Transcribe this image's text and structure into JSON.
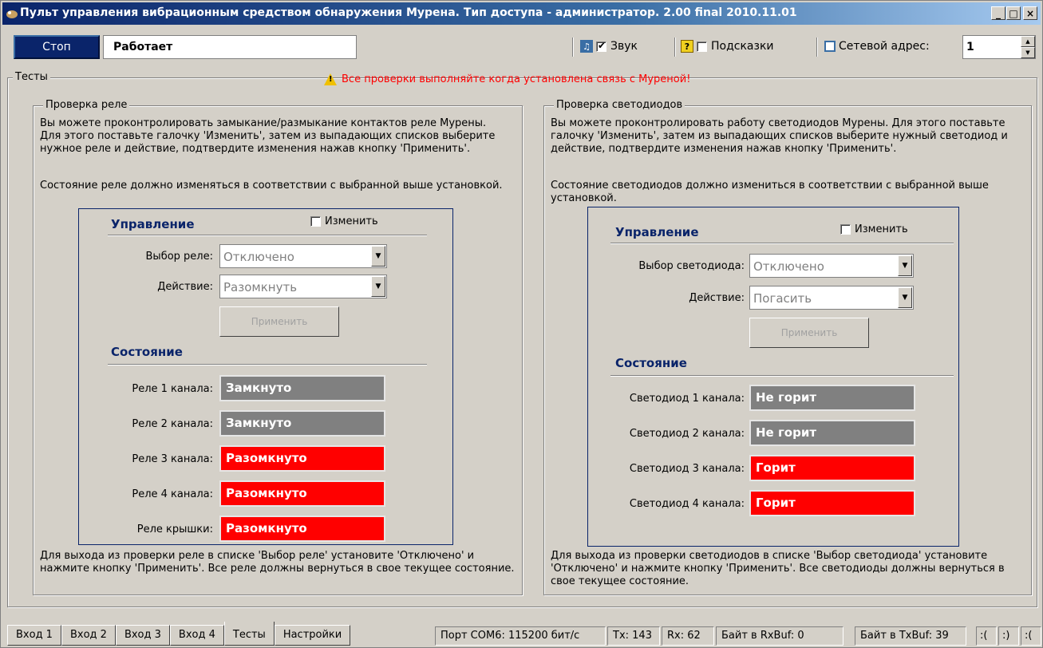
{
  "window": {
    "title": "Пульт управления вибрационным средством обнаружения Мурена. Тип доступа - администратор. 2.00 final 2010.11.01",
    "controls": [
      "_",
      "□",
      "×"
    ]
  },
  "toolbar": {
    "stop_label": "Стоп",
    "status": "Работает",
    "sound_label": "Звук",
    "sound_checked": true,
    "hints_label": "Подсказки",
    "hints_checked": false,
    "netaddr_label": "Сетевой адрес:",
    "netaddr_value": "1"
  },
  "tests": {
    "legend": "Тесты",
    "warning": "Все проверки выполняйте когда установлена связь с Муреной!",
    "relay": {
      "legend": "Проверка реле",
      "desc1": "Вы можете проконтролировать замыкание/размыкание контактов реле Мурены. Для этого поставьте галочку 'Изменить', затем из выпадающих списков выберите нужное реле и действие, подтвердите изменения нажав кнопку 'Применить'.",
      "desc2": "Состояние реле должно изменяться в соответствии с выбранной выше установкой.",
      "control_head": "Управление",
      "change_label": "Изменить",
      "select_label": "Выбор реле:",
      "select_value": "Отключено",
      "action_label": "Действие:",
      "action_value": "Разомкнуть",
      "apply_label": "Применить",
      "state_head": "Состояние",
      "states": [
        {
          "label": "Реле 1 канала:",
          "value": "Замкнуто",
          "color": "grey"
        },
        {
          "label": "Реле 2 канала:",
          "value": "Замкнуто",
          "color": "grey"
        },
        {
          "label": "Реле 3 канала:",
          "value": "Разомкнуто",
          "color": "red"
        },
        {
          "label": "Реле 4 канала:",
          "value": "Разомкнуто",
          "color": "red"
        },
        {
          "label": "Реле крышки:",
          "value": "Разомкнуто",
          "color": "red"
        }
      ],
      "footer": "Для выхода из проверки реле в списке 'Выбор реле' установите 'Отключено' и нажмите кнопку 'Применить'. Все реле должны вернуться в свое текущее состояние."
    },
    "led": {
      "legend": "Проверка светодиодов",
      "desc1": "Вы можете проконтролировать работу светодиодов Мурены. Для этого поставьте галочку 'Изменить', затем из выпадающих списков выберите нужный светодиод и действие, подтвердите изменения нажав кнопку 'Применить'.",
      "desc2": "Состояние светодиодов должно измениться в соответствии с выбранной выше установкой.",
      "control_head": "Управление",
      "change_label": "Изменить",
      "select_label": "Выбор светодиода:",
      "select_value": "Отключено",
      "action_label": "Действие:",
      "action_value": "Погасить",
      "apply_label": "Применить",
      "state_head": "Состояние",
      "states": [
        {
          "label": "Светодиод 1 канала:",
          "value": "Не горит",
          "color": "grey"
        },
        {
          "label": "Светодиод 2 канала:",
          "value": "Не горит",
          "color": "grey"
        },
        {
          "label": "Светодиод 3 канала:",
          "value": "Горит",
          "color": "red"
        },
        {
          "label": "Светодиод 4 канала:",
          "value": "Горит",
          "color": "red"
        }
      ],
      "footer": "Для выхода из проверки светодиодов в списке 'Выбор светодиода' установите 'Отключено' и нажмите кнопку 'Применить'. Все светодиоды должны вернуться в свое текущее состояние."
    }
  },
  "tabs": [
    "Вход 1",
    "Вход 2",
    "Вход 3",
    "Вход 4",
    "Тесты",
    "Настройки"
  ],
  "active_tab": "Тесты",
  "statusbar": {
    "port": "Порт COM6: 115200 бит/с",
    "tx": "Tx: 143",
    "rx": "Rx: 62",
    "rxbuf": "Байт в RxBuf: 0",
    "txbuf": "Байт в TxBuf: 39",
    "faces": [
      ":(",
      ":)",
      ":("
    ]
  },
  "colors": {
    "title_bar": "#0a246a",
    "heading": "#0a246a",
    "state_grey": "#808080",
    "state_red": "#ff0000",
    "warning_text": "#ff0000"
  }
}
